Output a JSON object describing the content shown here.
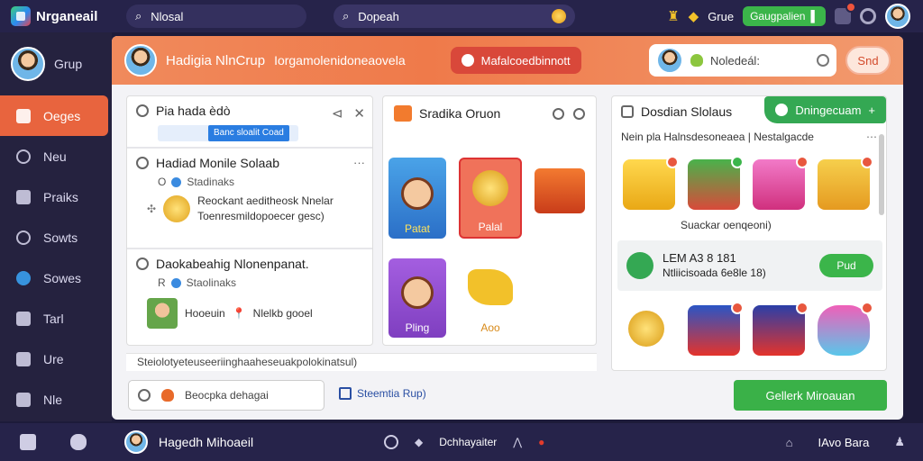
{
  "topbar": {
    "app_name": "Nrganeail",
    "search1": "Nlosal",
    "search2": "Dopeah",
    "group_label": "Grue",
    "green_pill": "Gaugpalien"
  },
  "sidebar": {
    "user": "Grup",
    "items": [
      {
        "label": "Oeges"
      },
      {
        "label": "Neu"
      },
      {
        "label": "Praiks"
      },
      {
        "label": "Sowts"
      },
      {
        "label": "Sowes"
      },
      {
        "label": "Tarl"
      },
      {
        "label": "Ure"
      },
      {
        "label": "Nle"
      }
    ]
  },
  "header": {
    "title": "Hadigia NlnCrup",
    "subtitle": "Iorgamolenidoneaovela",
    "red_pill": "Mafalcoedbinnott",
    "search_value": "Noledeál:",
    "send_label": "Snd"
  },
  "col1": {
    "top_title": "Pia hada èdò",
    "tag_label": "Banc sloalit Coad",
    "posts": [
      {
        "title": "Hadiad Monile Solaab",
        "meta": "Stadinaks",
        "body1": "Reockant aeditheosk Nnelar",
        "body2": "Toenresmildopoecer gesc)"
      },
      {
        "title": "Daokabeahig Nlonenpanat.",
        "meta": "Staolinaks",
        "body1": "Hooeuin",
        "body2": "Nlelkb gooel"
      }
    ]
  },
  "col2": {
    "title": "Sradika Oruon",
    "games": [
      {
        "label": "Patat"
      },
      {
        "label": "Palal"
      },
      {
        "label": "Pling"
      },
      {
        "label": "Aoo"
      }
    ]
  },
  "col3": {
    "title": "Dosdian Slolaus",
    "button": "Dningecuam",
    "subtitle": "Nein pla Halnsdesoneaea | Nestalgacde",
    "caption": "Suackar oenqeoni)",
    "promo_line1": "LEM A3 8 181",
    "promo_line2": "Ntliicisoada 6e8le 18)",
    "promo_button": "Pud"
  },
  "footer_text": "Steiolotyeteuseeriinghaaheseuakpolokinatsul)",
  "composer": {
    "input_placeholder": "Beocpka dehagai",
    "link": "Steemtia Rup)",
    "cta": "Gellerk Miroauan"
  },
  "bottombar": {
    "user": "Hagedh Mihoaeil",
    "middle": "Dchhayaiter",
    "right": "IAvo Bara"
  }
}
